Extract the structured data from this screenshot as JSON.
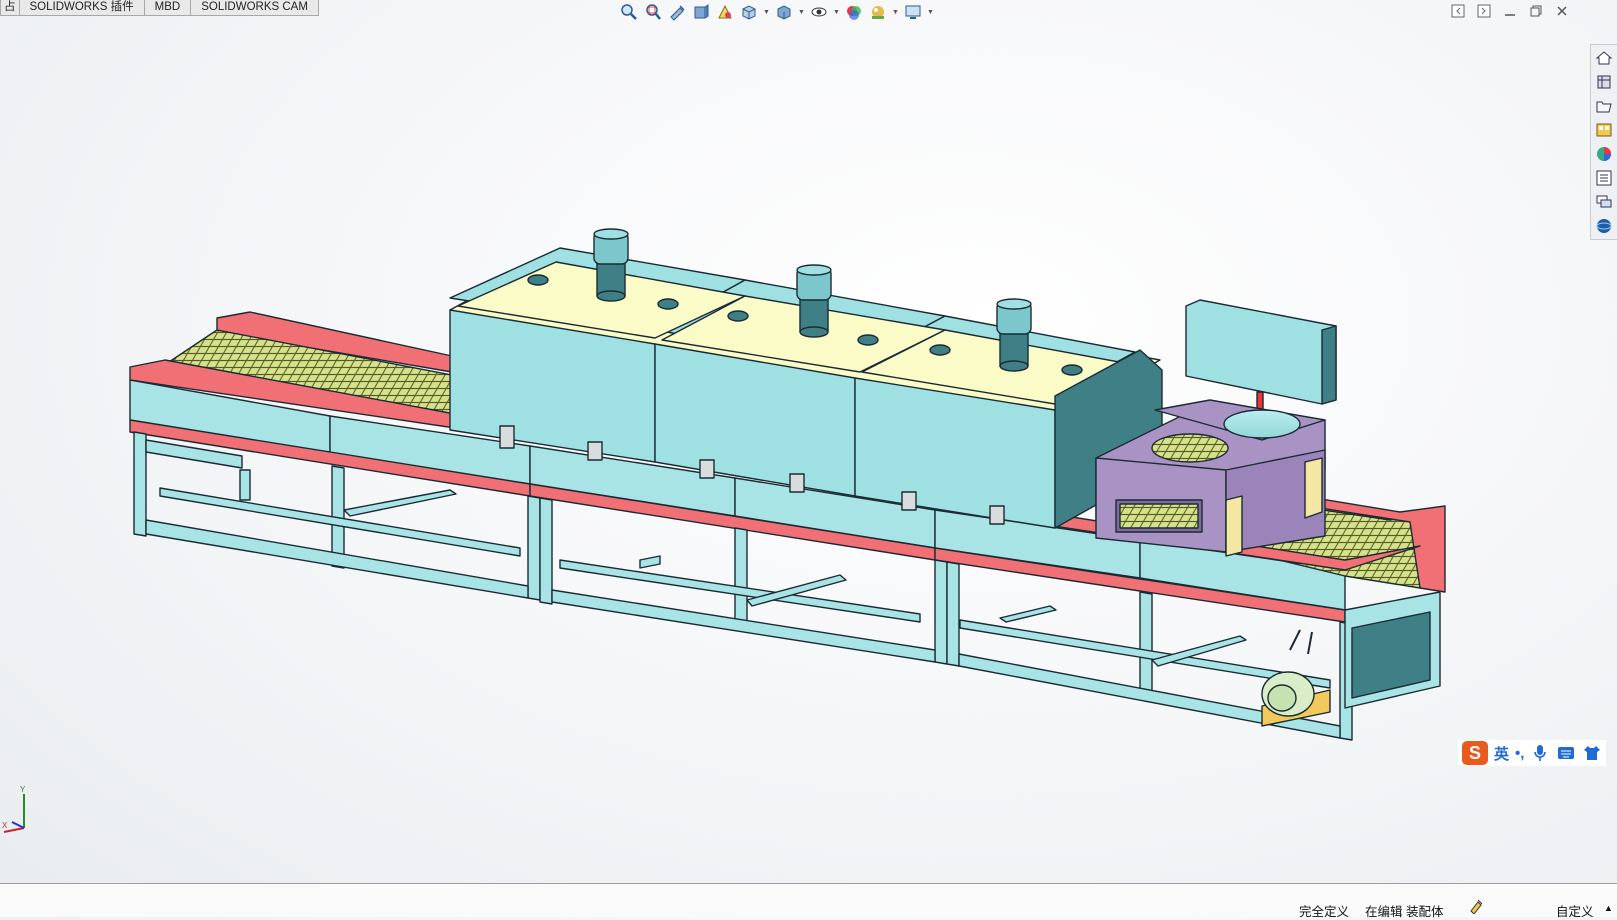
{
  "tabs": {
    "first": "占",
    "addins": "SOLIDWORKS 插件",
    "mbd": "MBD",
    "cam": "SOLIDWORKS CAM"
  },
  "hud_toolbar": {
    "icons": [
      "zoom-to-fit-icon",
      "zoom-to-area-icon",
      "previous-view-icon",
      "section-view-icon",
      "dynamic-annotation-view-icon",
      "view-orientation-icon",
      "display-style-icon",
      "hide-show-items-icon",
      "edit-appearance-icon",
      "apply-scene-icon",
      "view-settings-icon"
    ]
  },
  "task_pane": {
    "icons": [
      "solidworks-resources-icon",
      "design-library-icon",
      "file-explorer-icon",
      "view-palette-icon",
      "appearances-scenes-icon",
      "custom-properties-icon",
      "solidworks-forum-icon",
      "3dexperience-icon"
    ]
  },
  "ime": {
    "logo": "S",
    "mode": "英",
    "punct": "•,"
  },
  "triad": {
    "y": "Y",
    "x": "X"
  },
  "status": {
    "fully_defined": "完全定义",
    "editing": "在编辑 装配体",
    "units": "自定义"
  },
  "colors": {
    "frame": "#a8e3e6",
    "cover": "#9fe0e2",
    "top_panel": "#fbfbc8",
    "rail": "#f07075",
    "mesh": "#cfe080",
    "purple_box": "#a993c4",
    "motor": "#3f7f86"
  }
}
